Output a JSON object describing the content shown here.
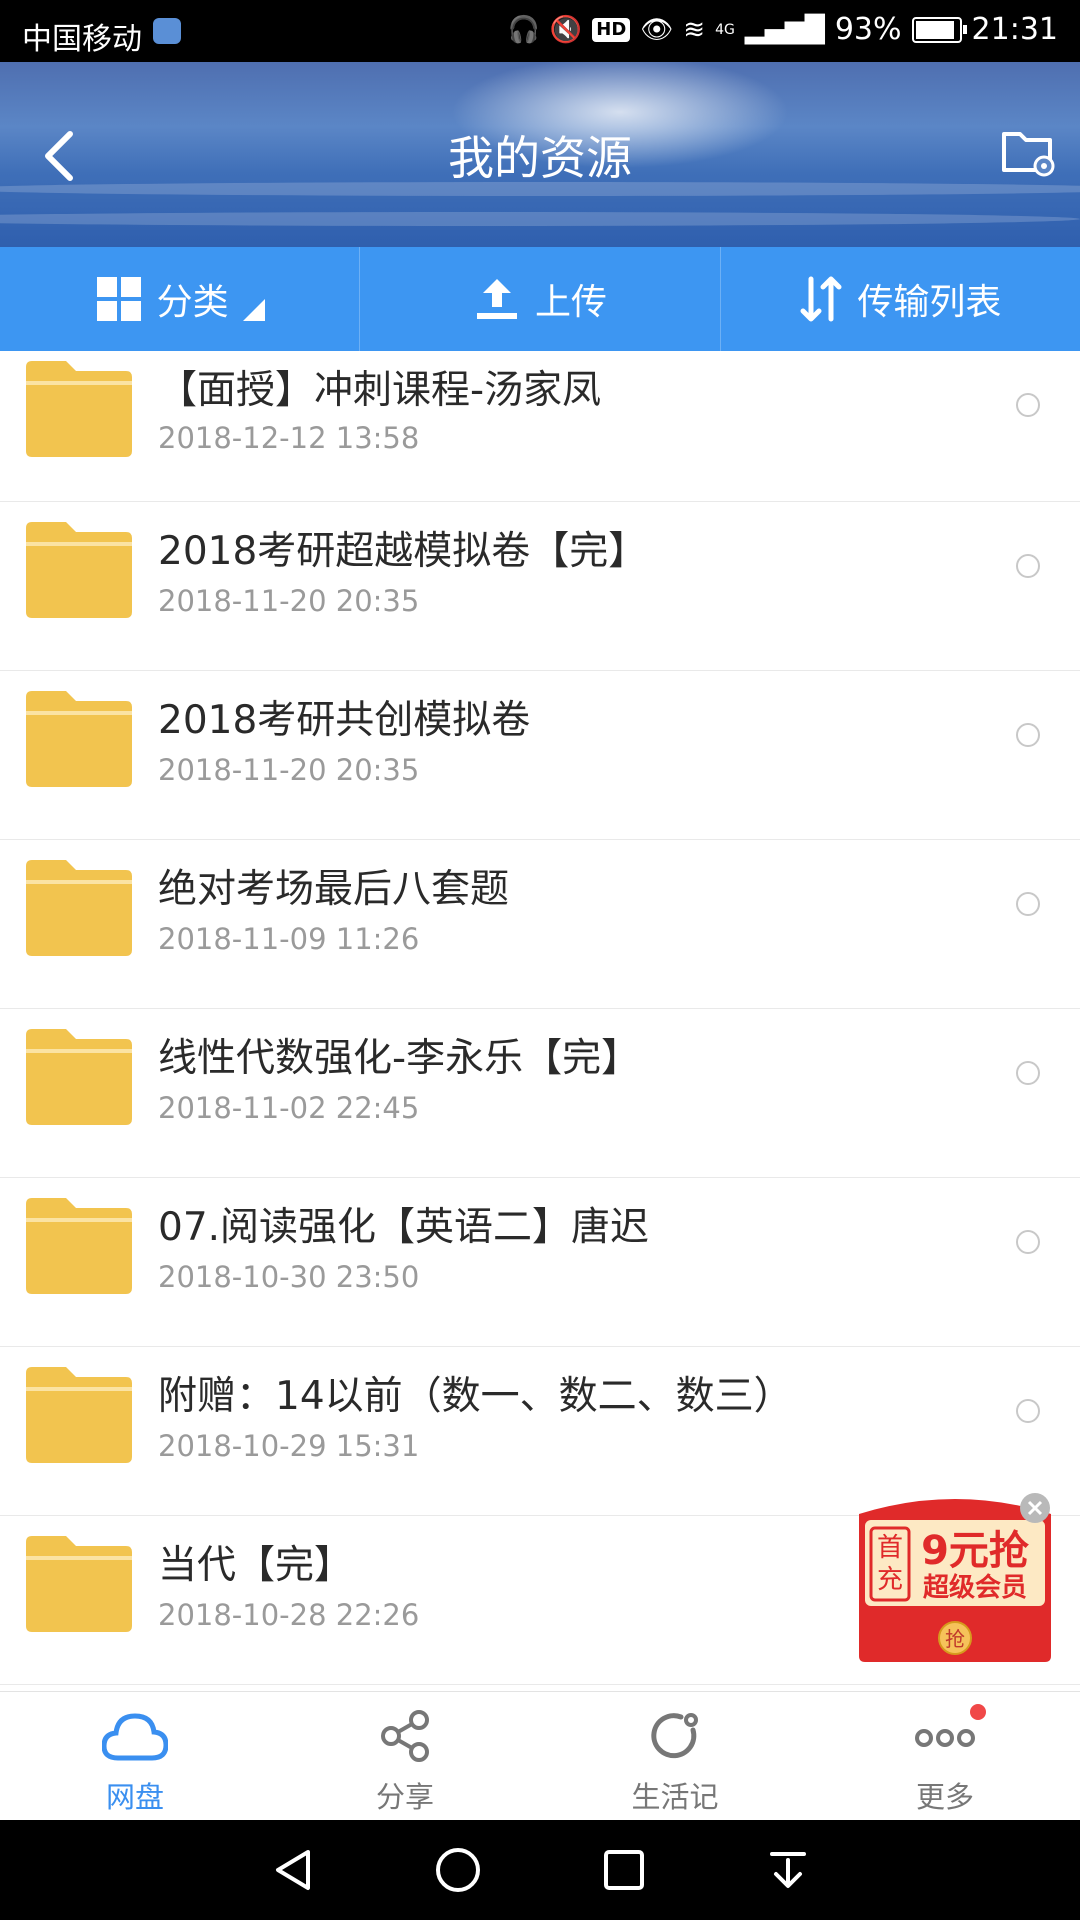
{
  "status_bar": {
    "carrier": "中国移动",
    "network": "4G",
    "battery": "93%",
    "time": "21:31"
  },
  "header": {
    "title": "我的资源"
  },
  "tabs": [
    {
      "label": "分类"
    },
    {
      "label": "上传"
    },
    {
      "label": "传输列表"
    }
  ],
  "files": [
    {
      "name": "【面授】冲刺课程-汤家凤",
      "date": "2018-12-12  13:58"
    },
    {
      "name": "2018考研超越模拟卷【完】",
      "date": "2018-11-20  20:35"
    },
    {
      "name": "2018考研共创模拟卷",
      "date": "2018-11-20  20:35"
    },
    {
      "name": "绝对考场最后八套题",
      "date": "2018-11-09  11:26"
    },
    {
      "name": "线性代数强化-李永乐【完】",
      "date": "2018-11-02  22:45"
    },
    {
      "name": "07.阅读强化【英语二】唐迟",
      "date": "2018-10-30  23:50"
    },
    {
      "name": "附赠：14以前（数一、数二、数三）",
      "date": "2018-10-29  15:31"
    },
    {
      "name": "当代【完】",
      "date": "2018-10-28  22:26"
    }
  ],
  "promo": {
    "tag_line1": "首",
    "tag_line2": "充",
    "headline": "9元抢",
    "subline": "超级会员",
    "button": "抢"
  },
  "bottom_nav": [
    {
      "label": "网盘",
      "active": true
    },
    {
      "label": "分享"
    },
    {
      "label": "生活记"
    },
    {
      "label": "更多"
    }
  ],
  "colors": {
    "accent": "#3d96f2",
    "folder": "#f2c44f",
    "promo_red": "#e02a2a"
  }
}
